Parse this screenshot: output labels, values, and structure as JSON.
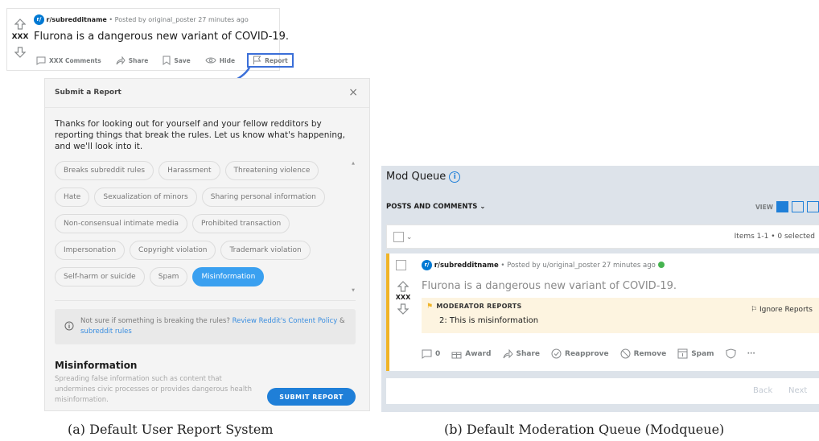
{
  "post": {
    "subreddit": "r/subredditname",
    "posted_by": " • Posted by original_poster 27 minutes ago",
    "vote_count": "XXX",
    "title": "Flurona is a dangerous new variant of COVID-19.",
    "avatar_letter": "r/",
    "actions": {
      "comments": "XXX Comments",
      "share": "Share",
      "save": "Save",
      "hide": "Hide",
      "report": "Report"
    }
  },
  "report_dialog": {
    "title": "Submit a Report",
    "close": "×",
    "description": "Thanks for looking out for yourself and your fellow redditors by reporting things that break the rules. Let us know what's happening, and we'll look into it.",
    "chips": [
      [
        "Breaks subreddit rules",
        "Harassment",
        "Threatening violence"
      ],
      [
        "Hate",
        "Sexualization of minors",
        "Sharing personal information"
      ],
      [
        "Non-consensual intimate media",
        "Prohibited transaction"
      ],
      [
        "Impersonation",
        "Copyright violation",
        "Trademark violation"
      ],
      [
        "Self-harm or suicide",
        "Spam",
        "Misinformation"
      ]
    ],
    "selected_chip": "Misinformation",
    "info_text_plain": "Not sure if something is breaking the rules? ",
    "info_link_1": "Review Reddit's Content Policy",
    "info_amp": " & ",
    "info_link_2": "subreddit rules",
    "selected_title": "Misinformation",
    "selected_desc": "Spreading false information such as content that undermines civic processes or provides dangerous health misinformation.",
    "submit_label": "SUBMIT REPORT"
  },
  "modqueue": {
    "title": "Mod Queue",
    "filter": "POSTS AND COMMENTS",
    "view_label": "VIEW",
    "items_label": "Items 1-1 • 0 selected",
    "item": {
      "subreddit": "r/subredditname",
      "posted_by": " • Posted by u/original_poster 27 minutes ago",
      "vote_count": "XXX",
      "title": "Flurona is a dangerous new variant of COVID-19.",
      "reports_label": "MODERATOR REPORTS",
      "report_text": "2: This is misinformation",
      "ignore_label": "Ignore Reports",
      "actions": {
        "comments": "0",
        "award": "Award",
        "share": "Share",
        "reapprove": "Reapprove",
        "remove": "Remove",
        "spam": "Spam",
        "more": "···"
      }
    },
    "pager": {
      "back": "Back",
      "next": "Next"
    }
  },
  "captions": {
    "left": "(a) Default User Report System",
    "right": "(b) Default Moderation Queue (Modqueue)"
  },
  "colors": {
    "accent": "#1f7fd8",
    "selected_chip": "#3aa0f0",
    "report_highlight": "#3b6fd8",
    "queue_stripe": "#f0b427",
    "approved": "#46b450"
  }
}
